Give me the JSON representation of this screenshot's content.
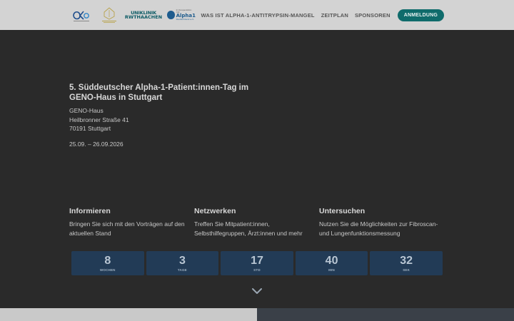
{
  "header": {
    "logos": {
      "logo1": {
        "name": "alpha1-center-logo",
        "text": "Alpha-1 Center"
      },
      "logo2": {
        "name": "institution-seal-logo"
      },
      "logo3": {
        "line1": "UNIKLINIK",
        "line2": "RWTHAACHEN"
      },
      "logo4": {
        "top": "In Kooperation mit",
        "name": "Alpha1",
        "sub": "Deutschland e.V."
      }
    },
    "nav": {
      "item1": "WAS IST ALPHA-1-ANTITRYPSIN-MANGEL",
      "item2": "ZEITPLAN",
      "item3": "SPONSOREN",
      "cta": "ANMELDUNG"
    }
  },
  "hero": {
    "title": "5. Süddeutscher Alpha-1-Patient:innen-Tag im GENO-Haus in Stuttgart",
    "address": {
      "line1": "GENO-Haus",
      "line2": "Heilbronner Straße 41",
      "line3": "70191 Stuttgart"
    },
    "dates": "25.09. – 26.09.2026"
  },
  "features": [
    {
      "title": "Informieren",
      "text": "Bringen Sie sich mit den Vorträgen auf den aktuellen Stand"
    },
    {
      "title": "Netzwerken",
      "text": "Treffen Sie Mitpatient:innen, Selbsthilfegruppen, Ärzt:innen und mehr"
    },
    {
      "title": "Untersuchen",
      "text": "Nutzen Sie die Möglichkeiten zur Fibroscan- und Lungenfunktionsmessung"
    }
  ],
  "countdown": [
    {
      "value": "8",
      "label": "WOCHEN"
    },
    {
      "value": "3",
      "label": "TAGE"
    },
    {
      "value": "17",
      "label": "STD"
    },
    {
      "value": "40",
      "label": "MIN"
    },
    {
      "value": "32",
      "label": "SEK"
    }
  ],
  "colors": {
    "background": "#2a2a2a",
    "header": "#d3d3d3",
    "accent": "#0f6b6b",
    "countdown_box": "#223b56"
  },
  "icons": {
    "scroll": "chevron-down-icon"
  }
}
